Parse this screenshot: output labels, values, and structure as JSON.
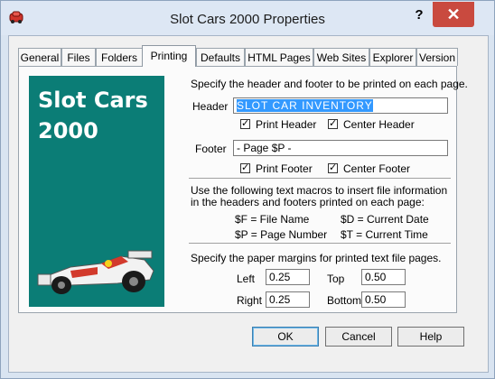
{
  "window": {
    "title": "Slot Cars 2000 Properties",
    "help_label": "?",
    "close_label": "✕"
  },
  "tabs": [
    "General",
    "Files",
    "Folders",
    "Printing",
    "Defaults",
    "HTML Pages",
    "Web Sites",
    "Explorer",
    "Version"
  ],
  "active_tab": "Printing",
  "logo": {
    "line1": "Slot Cars",
    "line2": "2000",
    "background": "#0b7d76"
  },
  "printing": {
    "intro": "Specify the header and footer to be printed on each page.",
    "header_label": "Header",
    "header_value": "SLOT CAR INVENTORY",
    "print_header_label": "Print Header",
    "center_header_label": "Center Header",
    "footer_label": "Footer",
    "footer_value": "- Page $P -",
    "print_footer_label": "Print Footer",
    "center_footer_label": "Center Footer",
    "macros_text_1": "Use the following text macros to insert file information",
    "macros_text_2": "in the headers and footers printed on each page:",
    "macro_f": "$F = File Name",
    "macro_d": "$D = Current Date",
    "macro_p": "$P = Page Number",
    "macro_t": "$T = Current Time",
    "margins_text": "Specify the paper margins for printed text file pages.",
    "left_label": "Left",
    "left_value": "0.25",
    "top_label": "Top",
    "top_value": "0.50",
    "right_label": "Right",
    "right_value": "0.25",
    "bottom_label": "Bottom",
    "bottom_value": "0.50"
  },
  "buttons": {
    "ok": "OK",
    "cancel": "Cancel",
    "help": "Help"
  }
}
